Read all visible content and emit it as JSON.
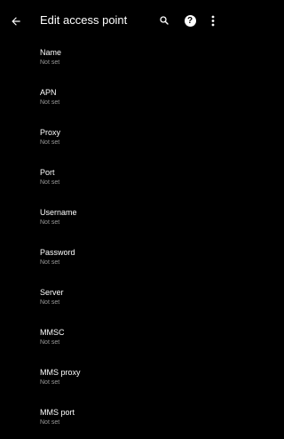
{
  "app_bar": {
    "title": "Edit access point",
    "icons": {
      "back": "arrow-back-icon",
      "search": "search-icon",
      "help": "help-icon",
      "more": "more-vert-icon"
    }
  },
  "preferences": [
    {
      "title": "Name",
      "summary": "Not set"
    },
    {
      "title": "APN",
      "summary": "Not set"
    },
    {
      "title": "Proxy",
      "summary": "Not set"
    },
    {
      "title": "Port",
      "summary": "Not set"
    },
    {
      "title": "Username",
      "summary": "Not set"
    },
    {
      "title": "Password",
      "summary": "Not set"
    },
    {
      "title": "Server",
      "summary": "Not set"
    },
    {
      "title": "MMSC",
      "summary": "Not set"
    },
    {
      "title": "MMS proxy",
      "summary": "Not set"
    },
    {
      "title": "MMS port",
      "summary": "Not set"
    }
  ],
  "colors": {
    "background": "#000000",
    "primary_text": "#ffffff",
    "secondary_text": "#9a9a9a"
  }
}
